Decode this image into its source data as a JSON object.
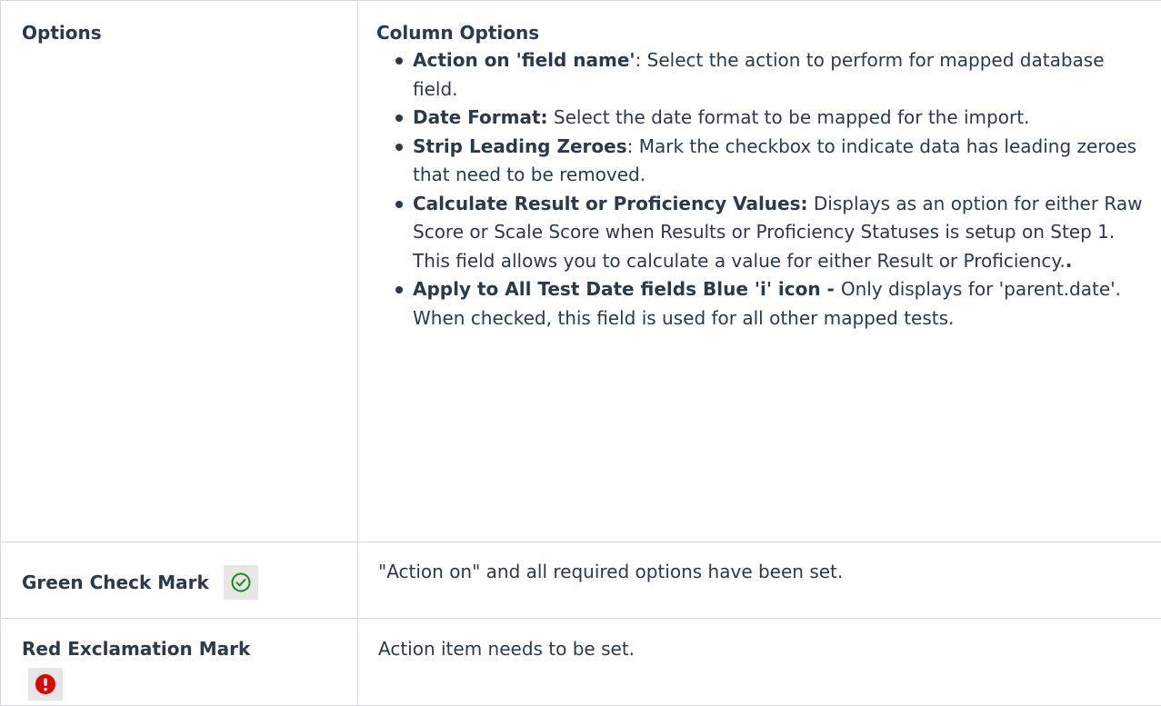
{
  "options_row": {
    "label": "Options",
    "heading": "Column Options",
    "items": [
      {
        "bold": "Action on 'field name'",
        "text": ": Select the action to perform for mapped database field."
      },
      {
        "bold": "Date Format:",
        "text": " Select the date format to be mapped for the import."
      },
      {
        "bold": "Strip Leading Zeroes",
        "text": ": Mark the checkbox to indicate data has leading zeroes that need to be removed."
      },
      {
        "bold": "Calculate Result or Proficiency Values:",
        "text": " Displays as an option for either Raw Score or Scale Score when Results or Proficiency Statuses is setup on Step 1. This field allows you to calculate a value for either Result or Proficiency.",
        "tail_bold": "."
      },
      {
        "bold": "Apply to All Test Date fields Blue 'i' icon - ",
        "text": " Only displays for 'parent.date'. When checked, this field is used for all other mapped tests."
      }
    ]
  },
  "green_row": {
    "label": "Green Check Mark",
    "icon": "check-circle-icon",
    "icon_color": "#1a8a1a",
    "description": "\"Action on\" and all required options have been set."
  },
  "red_row": {
    "label": "Red Exclamation Mark",
    "icon": "exclamation-circle-icon",
    "icon_color": "#e00000",
    "description": "Action item needs to be set."
  }
}
